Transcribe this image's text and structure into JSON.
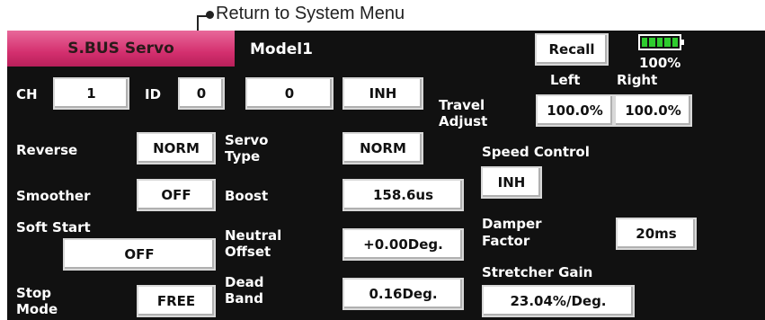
{
  "callout": {
    "text": "Return to System Menu"
  },
  "header": {
    "title": "S.BUS Servo",
    "model": "Model1",
    "recall": "Recall",
    "battery_percent": "100%",
    "battery_level": 1.0
  },
  "ch": {
    "label": "CH",
    "value": "1"
  },
  "id": {
    "label": "ID",
    "value1": "0",
    "value2": "0"
  },
  "inh_button": "INH",
  "travel_adjust": {
    "label_line1": "Travel",
    "label_line2": "Adjust",
    "left_label": "Left",
    "right_label": "Right",
    "left_value": "100.0%",
    "right_value": "100.0%"
  },
  "reverse": {
    "label": "Reverse",
    "value": "NORM"
  },
  "servo_type": {
    "label_line1": "Servo",
    "label_line2": "Type",
    "value": "NORM"
  },
  "speed_control": {
    "label": "Speed Control",
    "value": "INH"
  },
  "smoother": {
    "label": "Smoother",
    "value": "OFF"
  },
  "boost": {
    "label": "Boost",
    "value": "158.6us"
  },
  "soft_start": {
    "label": "Soft Start",
    "value": "OFF"
  },
  "neutral_offset": {
    "label_line1": "Neutral",
    "label_line2": "Offset",
    "value": "+0.00Deg."
  },
  "damper_factor": {
    "label_line1": "Damper",
    "label_line2": "Factor",
    "value": "20ms"
  },
  "stretcher_gain": {
    "label": "Stretcher Gain",
    "value": "23.04%/Deg."
  },
  "stop_mode": {
    "label_line1": "Stop",
    "label_line2": "Mode",
    "value": "FREE"
  },
  "dead_band": {
    "label_line1": "Dead",
    "label_line2": "Band",
    "value": "0.16Deg."
  },
  "colors": {
    "title_tab": "#d4306f",
    "screen_bg": "#111111",
    "battery": "#2ecc2e"
  }
}
